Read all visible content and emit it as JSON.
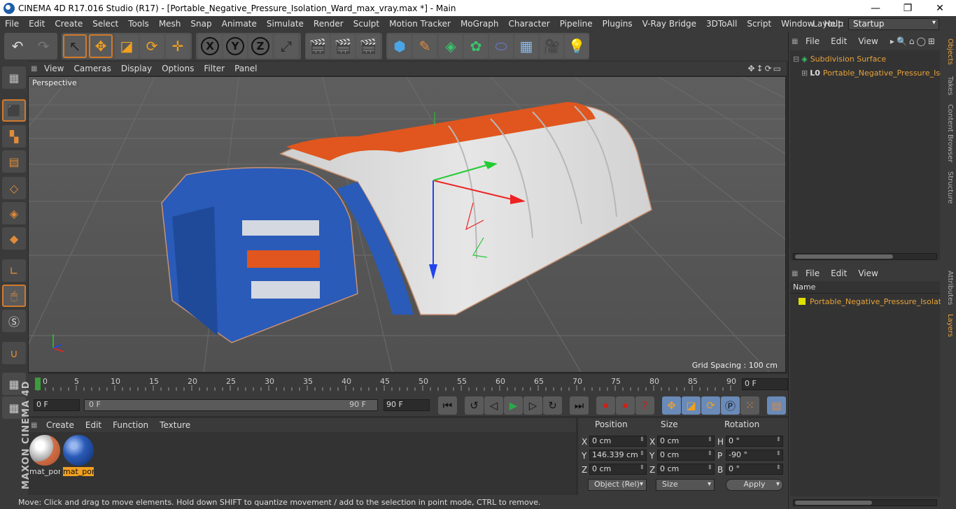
{
  "window": {
    "title": "CINEMA 4D R17.016 Studio (R17) - [Portable_Negative_Pressure_Isolation_Ward_max_vray.max *] - Main",
    "minimize": "—",
    "maximize": "❐",
    "close": "✕"
  },
  "menu": [
    "File",
    "Edit",
    "Create",
    "Select",
    "Tools",
    "Mesh",
    "Snap",
    "Animate",
    "Simulate",
    "Render",
    "Sculpt",
    "Motion Tracker",
    "MoGraph",
    "Character",
    "Pipeline",
    "Plugins",
    "V-Ray Bridge",
    "3DToAll",
    "Script",
    "Window",
    "Help"
  ],
  "layout": {
    "label": "Layout:",
    "value": "Startup"
  },
  "toolbar": {
    "axis_x": "X",
    "axis_y": "Y",
    "axis_z": "Z"
  },
  "viewport": {
    "menu": [
      "View",
      "Cameras",
      "Display",
      "Options",
      "Filter",
      "Panel"
    ],
    "camera": "Perspective",
    "grid_spacing": "Grid Spacing : 100 cm"
  },
  "timeline": {
    "ticks": [
      "0",
      "5",
      "10",
      "15",
      "20",
      "25",
      "30",
      "35",
      "40",
      "45",
      "50",
      "55",
      "60",
      "65",
      "70",
      "75",
      "80",
      "85",
      "90"
    ],
    "current_frame": "0 F"
  },
  "playback": {
    "start": "0 F",
    "slider_start": "0 F",
    "slider_end": "90 F",
    "end": "90 F"
  },
  "material_menu": [
    "Create",
    "Edit",
    "Function",
    "Texture"
  ],
  "materials": [
    {
      "label": "mat_por"
    },
    {
      "label": "mat_por"
    }
  ],
  "coords": {
    "headers": {
      "position": "Position",
      "size": "Size",
      "rotation": "Rotation"
    },
    "pos": {
      "x": "0 cm",
      "y": "146.339 cm",
      "z": "0 cm"
    },
    "size": {
      "x": "0 cm",
      "y": "0 cm",
      "z": "0 cm"
    },
    "rot": {
      "h": "0 °",
      "p": "-90 °",
      "b": "0 °"
    },
    "labels": {
      "x": "X",
      "y": "Y",
      "z": "Z",
      "h": "H",
      "p": "P",
      "b": "B"
    },
    "mode": "Object (Rel)",
    "size_mode": "Size",
    "apply": "Apply"
  },
  "status": "Move: Click and drag to move elements. Hold down SHIFT to quantize movement / add to the selection in point mode, CTRL to remove.",
  "brand": "MAXON CINEMA 4D",
  "objects_panel": {
    "menu": [
      "File",
      "Edit",
      "View"
    ],
    "items": [
      "Subdivision Surface",
      "Portable_Negative_Pressure_Isola"
    ]
  },
  "layers_panel": {
    "menu": [
      "File",
      "Edit",
      "View"
    ],
    "name_header": "Name",
    "items": [
      "Portable_Negative_Pressure_Isolat"
    ]
  },
  "side_tabs": [
    "Objects",
    "Takes",
    "Content Browser",
    "Structure",
    "Attributes",
    "Layers"
  ],
  "colors": {
    "accent": "#d07a2c",
    "object_name": "#e8a33a",
    "tent_blue": "#2a5bb8",
    "tent_orange": "#e0561e"
  }
}
